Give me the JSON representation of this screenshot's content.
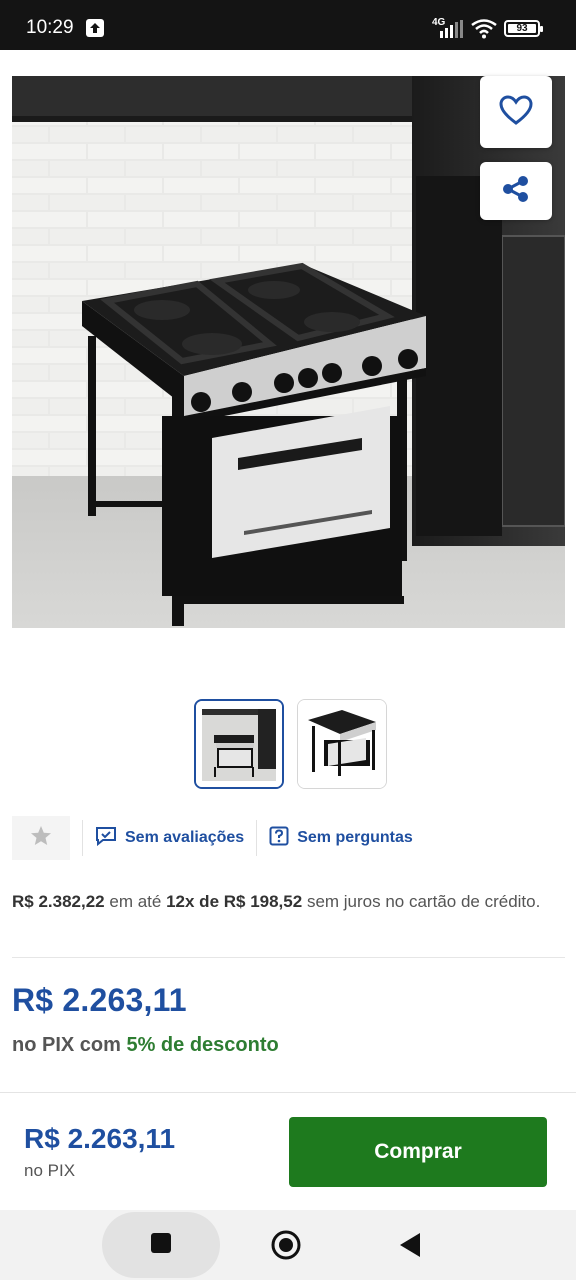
{
  "status_bar": {
    "time": "10:29",
    "network": "4G",
    "battery": "93",
    "icons": [
      "upload-icon",
      "signal-icon",
      "wifi-icon",
      "battery-icon"
    ]
  },
  "product": {
    "images": [
      "stove-in-kitchen",
      "stove-white-background"
    ],
    "selected_image": 0
  },
  "actions": {
    "icons": [
      "heart-icon",
      "share-icon"
    ]
  },
  "ratings": {
    "reviews_label": "Sem avaliações",
    "questions_label": "Sem perguntas",
    "icons": [
      "star-icon",
      "review-icon",
      "question-icon"
    ]
  },
  "installment": {
    "full_price": "R$ 2.382,22",
    "text_1": "em até",
    "plan": "12x de R$ 198,52",
    "text_2": "sem juros no cartão de crédito."
  },
  "pix": {
    "price": "R$ 2.263,11",
    "text": "no PIX com",
    "discount": "5% de desconto"
  },
  "bottom_bar": {
    "price": "R$ 2.263,11",
    "pix_label": "no PIX",
    "buy_label": "Comprar"
  },
  "colors": {
    "accent": "#1f4fa0",
    "buy": "#1e7a1e",
    "discount": "#2e7d32"
  }
}
